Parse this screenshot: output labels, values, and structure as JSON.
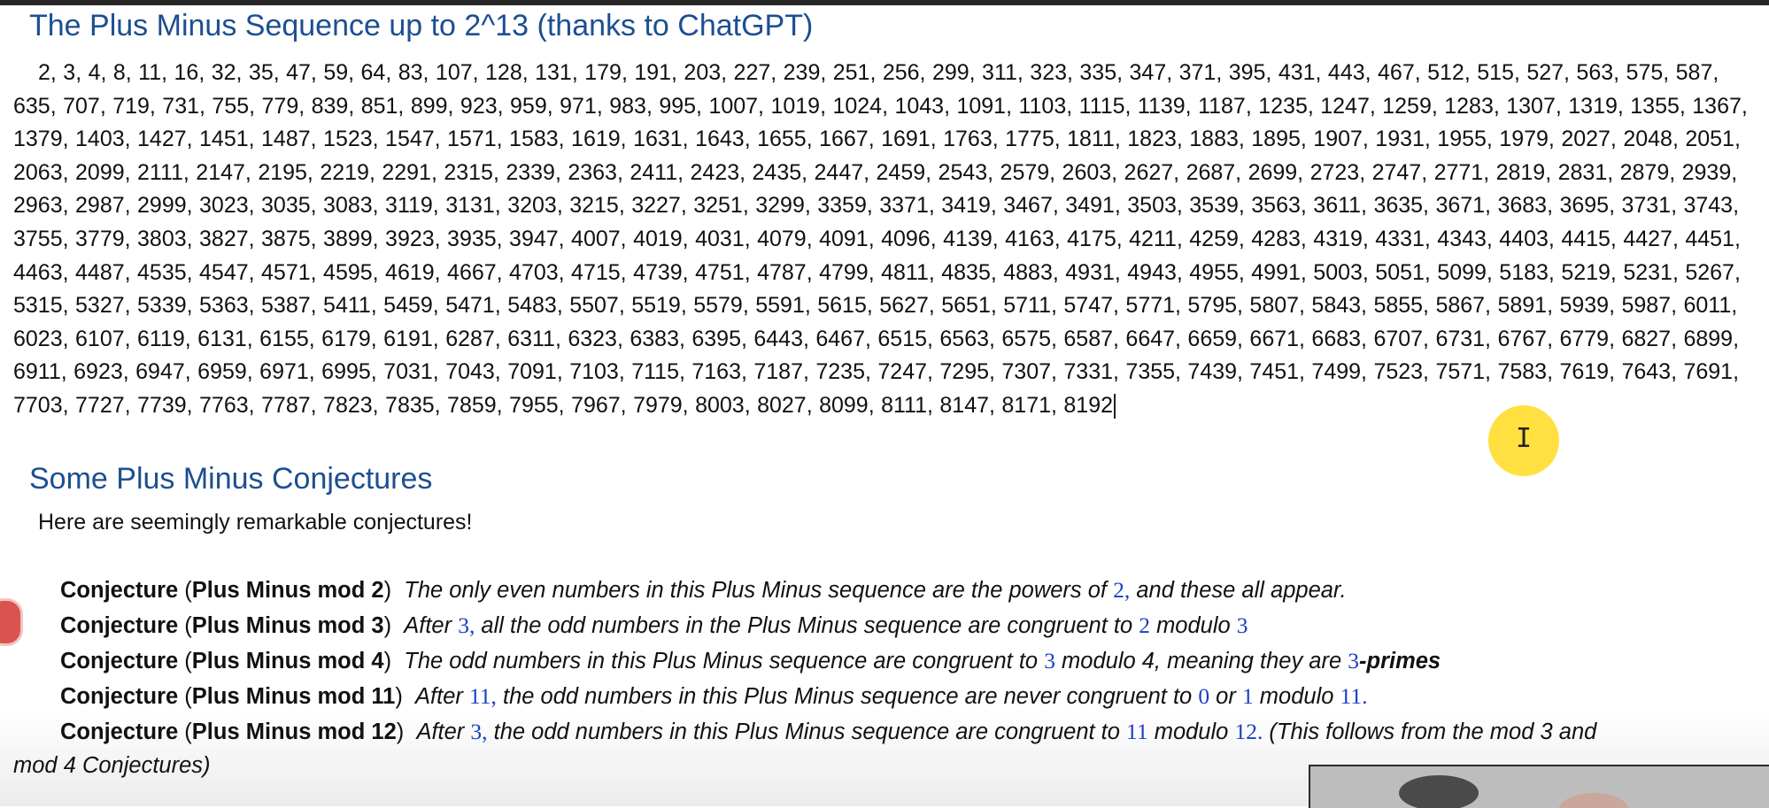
{
  "title": "The Plus Minus Sequence up to 2^13 (thanks to ChatGPT)",
  "sequence_text": "2, 3, 4, 8, 11, 16, 32, 35, 47, 59, 64, 83, 107, 128, 131, 179, 191, 203, 227, 239, 251, 256, 299, 311, 323, 335, 347, 371, 395, 431, 443, 467, 512, 515, 527, 563, 575, 587, 635, 707, 719, 731, 755, 779, 839, 851, 899, 923, 959, 971, 983, 995, 1007, 1019, 1024, 1043, 1091, 1103, 1115, 1139, 1187, 1235, 1247, 1259, 1283, 1307, 1319, 1355, 1367, 1379, 1403, 1427, 1451, 1487, 1523, 1547, 1571, 1583, 1619, 1631, 1643, 1655, 1667, 1691, 1763, 1775, 1811, 1823, 1883, 1895, 1907, 1931, 1955, 1979, 2027, 2048, 2051, 2063, 2099, 2111, 2147, 2195, 2219, 2291, 2315, 2339, 2363, 2411, 2423, 2435, 2447, 2459, 2543, 2579, 2603, 2627, 2687, 2699, 2723, 2747, 2771, 2819, 2831, 2879, 2939, 2963, 2987, 2999, 3023, 3035, 3083, 3119, 3131, 3203, 3215, 3227, 3251, 3299, 3359, 3371, 3419, 3467, 3491, 3503, 3539, 3563, 3611, 3635, 3671, 3683, 3695, 3731, 3743, 3755, 3779, 3803, 3827, 3875, 3899, 3923, 3935, 3947, 4007, 4019, 4031, 4079, 4091, 4096, 4139, 4163, 4175, 4211, 4259, 4283, 4319, 4331, 4343, 4403, 4415, 4427, 4451, 4463, 4487, 4535, 4547, 4571, 4595, 4619, 4667, 4703, 4715, 4739, 4751, 4787, 4799, 4811, 4835, 4883, 4931, 4943, 4955, 4991, 5003, 5051, 5099, 5183, 5219, 5231, 5267, 5315, 5327, 5339, 5363, 5387, 5411, 5459, 5471, 5483, 5507, 5519, 5579, 5591, 5615, 5627, 5651, 5711, 5747, 5771, 5795, 5807, 5843, 5855, 5867, 5891, 5939, 5987, 6011, 6023, 6107, 6119, 6131, 6155, 6179, 6191, 6287, 6311, 6323, 6383, 6395, 6443, 6467, 6515, 6563, 6575, 6587, 6647, 6659, 6671, 6683, 6707, 6731, 6767, 6779, 6827, 6899, 6911, 6923, 6947, 6959, 6971, 6995, 7031, 7043, 7091, 7103, 7115, 7163, 7187, 7235, 7247, 7295, 7307, 7331, 7355, 7439, 7451, 7499, 7523, 7571, 7583, 7619, 7643, 7691, 7703, 7727, 7739, 7763, 7787, 7823, 7835, 7859, 7955, 7967, 7979, 8003, 8027, 8099, 8111, 8147, 8171, 8192",
  "subtitle": "Some Plus Minus Conjectures",
  "intro": "Here are seemingly remarkable conjectures!",
  "conjectures": [
    {
      "word": "Conjecture",
      "open": "(",
      "name": "Plus Minus mod 2",
      "close": ")",
      "parts": [
        "The only even numbers in this Plus Minus sequence are the powers of",
        "2,",
        "and these all appear."
      ]
    },
    {
      "word": "Conjecture",
      "open": "(",
      "name": "Plus Minus mod 3",
      "close": ")",
      "parts": [
        "After",
        "3,",
        "all the odd numbers in the Plus Minus sequence are congruent to",
        "2",
        "modulo",
        "3"
      ]
    },
    {
      "word": "Conjecture",
      "open": "(",
      "name": "Plus Minus mod 4",
      "close": ")",
      "parts": [
        "The odd numbers in this Plus Minus sequence are congruent to",
        "3",
        "modulo 4, meaning they are",
        "3",
        "-primes"
      ]
    },
    {
      "word": "Conjecture",
      "open": "(",
      "name": "Plus Minus mod 11",
      "close": ")",
      "parts": [
        "After",
        "11,",
        "the odd numbers in this Plus Minus sequence are never congruent to",
        "0",
        "or",
        "1",
        "modulo",
        "11."
      ]
    },
    {
      "word": "Conjecture",
      "open": "(",
      "name": "Plus Minus mod 12",
      "close": ")",
      "parts": [
        "After",
        "3,",
        "the odd numbers in this Plus Minus sequence are congruent to",
        "11",
        "modulo",
        "12.",
        "(This follows from the mod 3 and"
      ]
    }
  ],
  "continuation": "mod 4 Conjectures)",
  "colors": {
    "heading": "#1c4f91",
    "math_number": "#1a3fc4",
    "cursor_highlight": "#ffd600"
  },
  "icons": [
    "text-cursor-icon",
    "record-icon"
  ]
}
